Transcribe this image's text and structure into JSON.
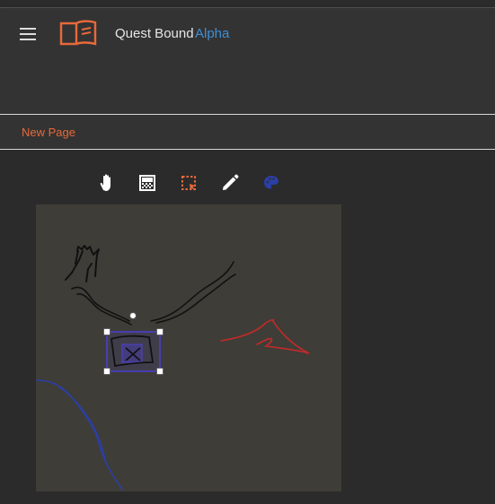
{
  "app": {
    "title": "Quest Bound",
    "badge": "Alpha",
    "brand_color": "#e8693a",
    "badge_color": "#3f8fd2"
  },
  "header": {
    "menu_icon": "hamburger-menu-icon",
    "logo_icon": "open-book-logo-icon"
  },
  "tabs": [
    {
      "label": "New Page",
      "color": "#e8693a"
    }
  ],
  "toolbar": {
    "tools": [
      {
        "name": "pan-tool",
        "icon": "hand-icon"
      },
      {
        "name": "texture-tool",
        "icon": "gradient-icon"
      },
      {
        "name": "select-tool",
        "icon": "selection-icon",
        "color": "#e8693a"
      },
      {
        "name": "draw-tool",
        "icon": "pencil-icon"
      },
      {
        "name": "color-tool",
        "icon": "palette-icon",
        "color": "#2a3fa8"
      }
    ]
  },
  "canvas": {
    "background": "#3f3d38",
    "stroke_colors": [
      "#111111",
      "#c32a2a",
      "#2a3fa8"
    ],
    "selection_color": "#4b3fd6"
  }
}
